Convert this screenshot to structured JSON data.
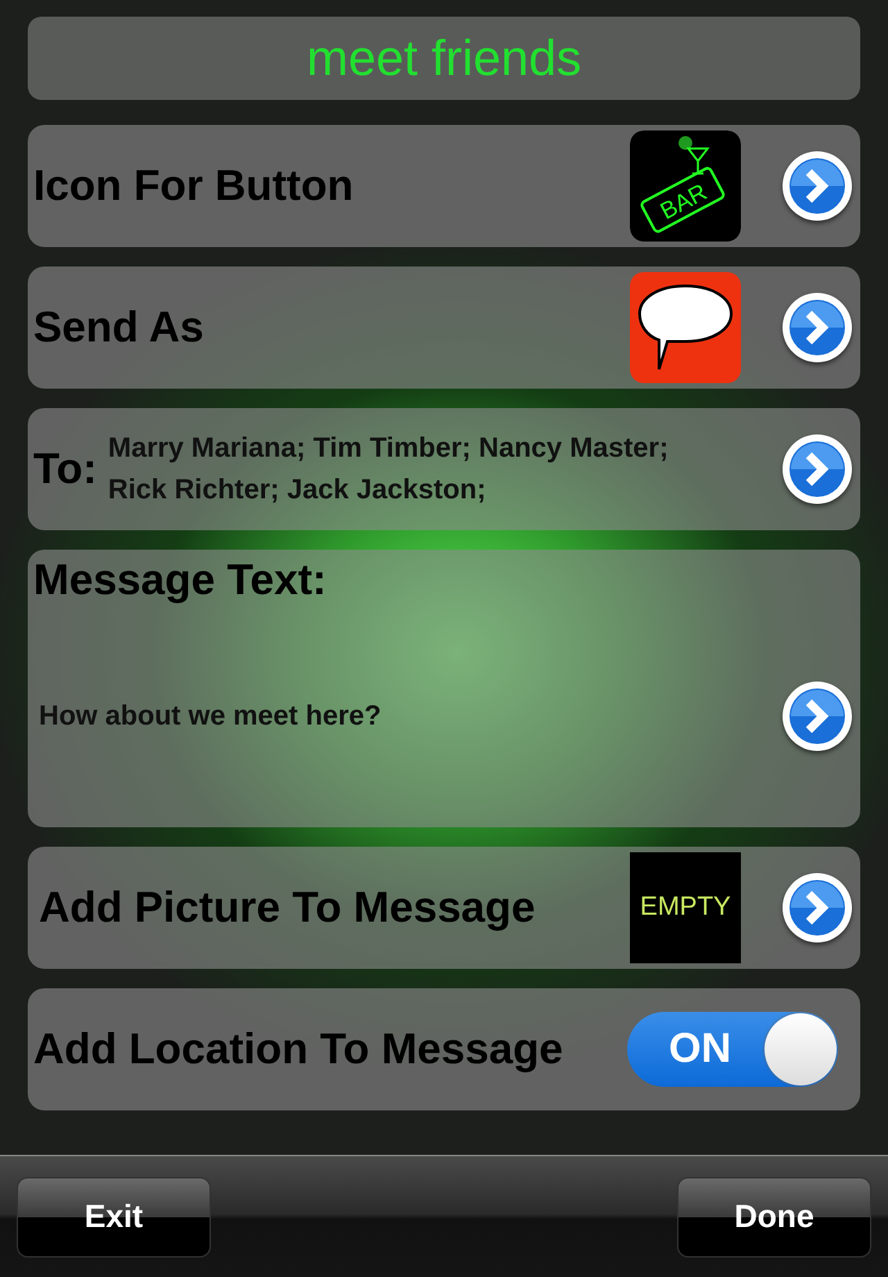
{
  "title": "meet friends",
  "rows": [
    {
      "kind": "sign",
      "label": "Icon For Button",
      "icon_text": "BAR"
    },
    {
      "kind": "bubble",
      "label": "Send As"
    },
    {
      "kind": "recipients",
      "label": "To:",
      "value": "Marry Mariana; Tim Timber; Nancy Master; Rick Richter; Jack Jackston;"
    },
    {
      "kind": "message",
      "label": "Message Text:",
      "value": "How about we meet here?"
    },
    {
      "kind": "picture",
      "label": "Add Picture To Message",
      "placeholder": "EMPTY"
    },
    {
      "kind": "toggle",
      "label": "Add Location To Message",
      "on": true,
      "on_text": "ON"
    }
  ],
  "toolbar": {
    "left": "Exit",
    "right": "Done"
  }
}
